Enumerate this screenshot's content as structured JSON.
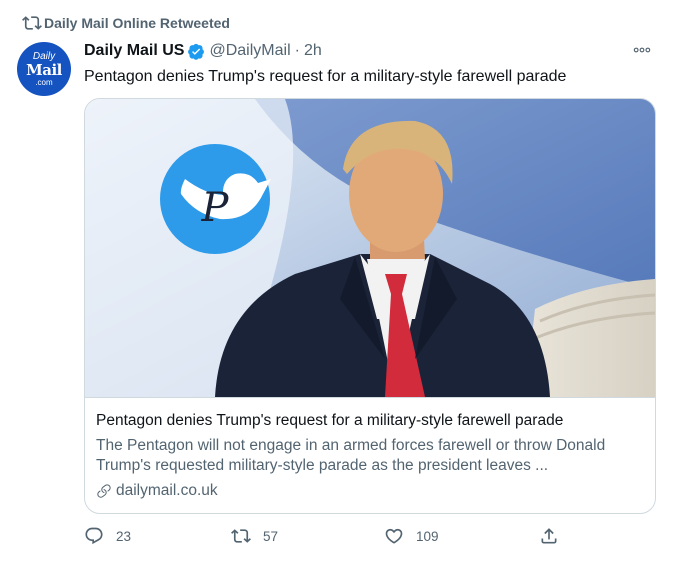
{
  "retweet": {
    "label": "Daily Mail Online Retweeted"
  },
  "author": {
    "avatar_lines": [
      "Daily",
      "Mail",
      ".com"
    ],
    "name": "Daily Mail US",
    "handle": "@DailyMail",
    "separator": "·",
    "time": "2h"
  },
  "tweet": {
    "text": "Pentagon denies Trump's request for a military-style farewell parade"
  },
  "card": {
    "title": "Pentagon denies Trump's request for a military-style farewell parade",
    "description": "The Pentagon will not engage in an armed forces farewell or throw Donald Trump's requested military-style parade as the president leaves ...",
    "domain": "dailymail.co.uk",
    "watermark_letter": "P"
  },
  "actions": {
    "reply_count": "23",
    "retweet_count": "57",
    "like_count": "109"
  },
  "colors": {
    "secondary_text": "#536471",
    "accent": "#1d9bf0",
    "border": "#cfd9de"
  }
}
